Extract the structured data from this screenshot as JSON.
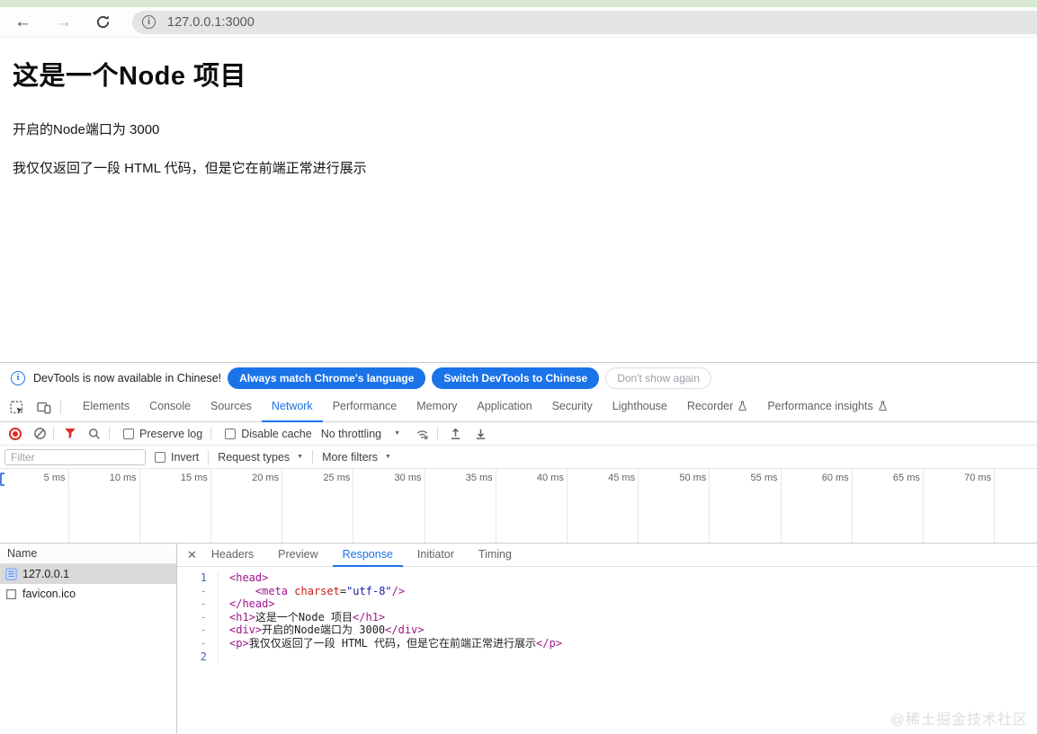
{
  "browser": {
    "url": "127.0.0.1:3000",
    "back_icon": "back-arrow-icon",
    "forward_icon": "forward-arrow-icon",
    "reload_icon": "reload-icon",
    "site_info_icon": "info-icon"
  },
  "page": {
    "title": "这是一个Node 项目",
    "line1": "开启的Node端口为 3000",
    "line2": "我仅仅返回了一段 HTML 代码，但是它在前端正常进行展示"
  },
  "infobar": {
    "message": "DevTools is now available in Chinese!",
    "buttons": [
      "Always match Chrome's language",
      "Switch DevTools to Chinese",
      "Don't show again"
    ]
  },
  "devtools": {
    "tabs": [
      {
        "label": "Elements"
      },
      {
        "label": "Console"
      },
      {
        "label": "Sources"
      },
      {
        "label": "Network",
        "active": true
      },
      {
        "label": "Performance"
      },
      {
        "label": "Memory"
      },
      {
        "label": "Application"
      },
      {
        "label": "Security"
      },
      {
        "label": "Lighthouse"
      },
      {
        "label": "Recorder",
        "flask": true
      },
      {
        "label": "Performance insights",
        "flask": true
      }
    ],
    "network_toolbar": {
      "preserve_log": "Preserve log",
      "disable_cache": "Disable cache",
      "throttling": "No throttling",
      "icons": [
        "record-icon",
        "clear-icon",
        "filter-funnel-icon",
        "search-icon",
        "network-conditions-icon",
        "import-har-icon",
        "export-har-icon"
      ]
    },
    "filter_bar": {
      "filter_placeholder": "Filter",
      "invert": "Invert",
      "request_types": "Request types",
      "more_filters": "More filters"
    },
    "timeline_ticks": [
      "5 ms",
      "10 ms",
      "15 ms",
      "20 ms",
      "25 ms",
      "30 ms",
      "35 ms",
      "40 ms",
      "45 ms",
      "50 ms",
      "55 ms",
      "60 ms",
      "65 ms",
      "70 ms"
    ],
    "requests": {
      "header": "Name",
      "rows": [
        {
          "name": "127.0.0.1",
          "icon": "document-icon",
          "selected": true
        },
        {
          "name": "favicon.ico",
          "icon": "file-icon",
          "selected": false
        }
      ]
    },
    "detail_tabs": [
      {
        "label": "Headers"
      },
      {
        "label": "Preview"
      },
      {
        "label": "Response",
        "active": true
      },
      {
        "label": "Initiator"
      },
      {
        "label": "Timing"
      }
    ],
    "response_code": {
      "lines": [
        {
          "num": "1",
          "segments": [
            {
              "c": "tag",
              "t": "<head>"
            }
          ]
        },
        {
          "num": "-",
          "segments": [
            {
              "c": "plain",
              "t": "    "
            },
            {
              "c": "tag",
              "t": "<meta"
            },
            {
              "c": "plain",
              "t": " "
            },
            {
              "c": "attr",
              "t": "charset"
            },
            {
              "c": "plain",
              "t": "="
            },
            {
              "c": "value",
              "t": "\"utf-8\""
            },
            {
              "c": "tag",
              "t": "/>"
            }
          ]
        },
        {
          "num": "-",
          "segments": [
            {
              "c": "tag",
              "t": "</head>"
            }
          ]
        },
        {
          "num": "-",
          "segments": [
            {
              "c": "tag",
              "t": "<h1>"
            },
            {
              "c": "plain",
              "t": "这是一个Node 项目"
            },
            {
              "c": "tag",
              "t": "</h1>"
            }
          ]
        },
        {
          "num": "-",
          "segments": [
            {
              "c": "tag",
              "t": "<div>"
            },
            {
              "c": "plain",
              "t": "开启的Node端口为 3000"
            },
            {
              "c": "tag",
              "t": "</div>"
            }
          ]
        },
        {
          "num": "-",
          "segments": [
            {
              "c": "tag",
              "t": "<p>"
            },
            {
              "c": "plain",
              "t": "我仅仅返回了一段 HTML 代码，但是它在前端正常进行展示"
            },
            {
              "c": "tag",
              "t": "</p>"
            }
          ]
        },
        {
          "num": "2",
          "segments": []
        }
      ]
    }
  },
  "watermark": "@稀土掘金技术社区",
  "colors": {
    "accent_blue": "#1a73e8",
    "record_red": "#d93025",
    "top_strip_green": "#d8e9d3",
    "selected_row_gray": "#d9d9d9",
    "token_tag": "#9c1889",
    "token_attr": "#c41a16",
    "token_value": "#1a1aa6"
  }
}
